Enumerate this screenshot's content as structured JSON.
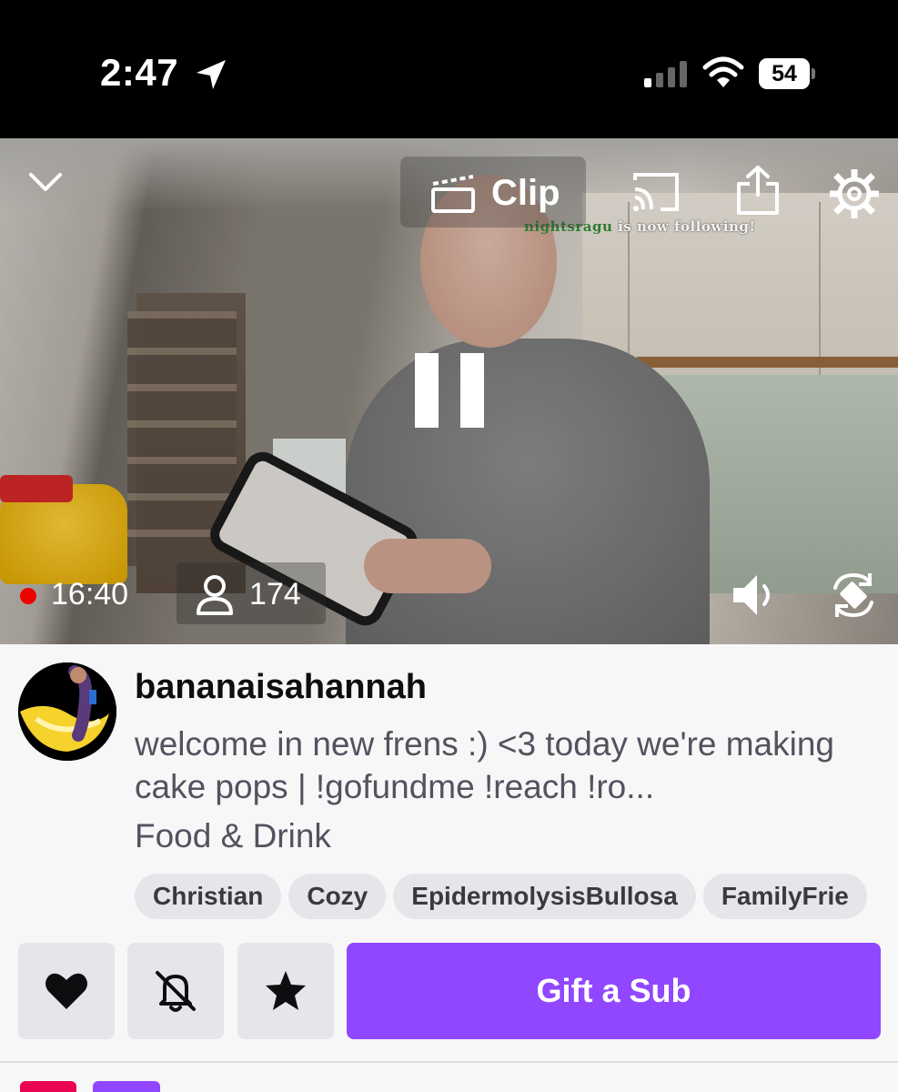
{
  "status_bar": {
    "time": "2:47",
    "battery": "54"
  },
  "player": {
    "clip_label": "Clip",
    "follow_alert_user": "nightsragu",
    "follow_alert_text": " is now following!",
    "uptime": "16:40",
    "viewer_count": "174"
  },
  "channel": {
    "name": "bananaisahannah",
    "title": "welcome in new frens :) <3 today we're making cake pops | !gofundme !reach !ro...",
    "category": "Food & Drink",
    "tags": [
      "Christian",
      "Cozy",
      "EpidermolysisBullosa",
      "FamilyFrie"
    ]
  },
  "actions": {
    "gift_label": "Gift a Sub"
  },
  "colors": {
    "accent": "#9147ff",
    "live": "#eb0400",
    "tag_bg": "#e6e6ea"
  }
}
